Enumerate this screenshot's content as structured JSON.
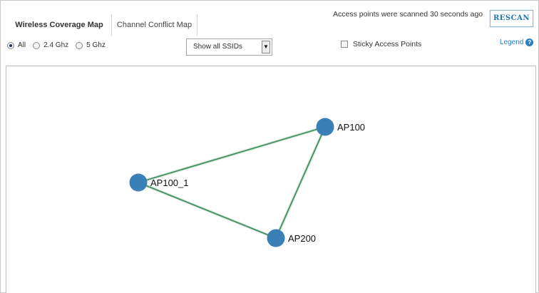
{
  "tabs": [
    {
      "label": "Wireless Coverage Map",
      "active": true
    },
    {
      "label": "Channel Conflict Map",
      "active": false
    }
  ],
  "scan_status": "Access points were scanned 30 seconds ago",
  "rescan_label": "RESCAN",
  "band_filter": {
    "selected": "All",
    "options": [
      "All",
      "2.4 Ghz",
      "5 Ghz"
    ]
  },
  "ssid_select": {
    "value": "Show all SSIDs"
  },
  "sticky_access_points": {
    "label": "Sticky Access Points",
    "checked": false
  },
  "legend": {
    "label": "Legend",
    "icon": "help-icon"
  },
  "map": {
    "node_color": "#3a7fb5",
    "link_color": "#3d8c5a",
    "nodes": [
      {
        "id": "AP100",
        "label": "AP100"
      },
      {
        "id": "AP100_1",
        "label": "AP100_1"
      },
      {
        "id": "AP200",
        "label": "AP200"
      }
    ],
    "links": [
      {
        "from": "AP100_1",
        "to": "AP100"
      },
      {
        "from": "AP100_1",
        "to": "AP200"
      },
      {
        "from": "AP100",
        "to": "AP200"
      }
    ]
  }
}
